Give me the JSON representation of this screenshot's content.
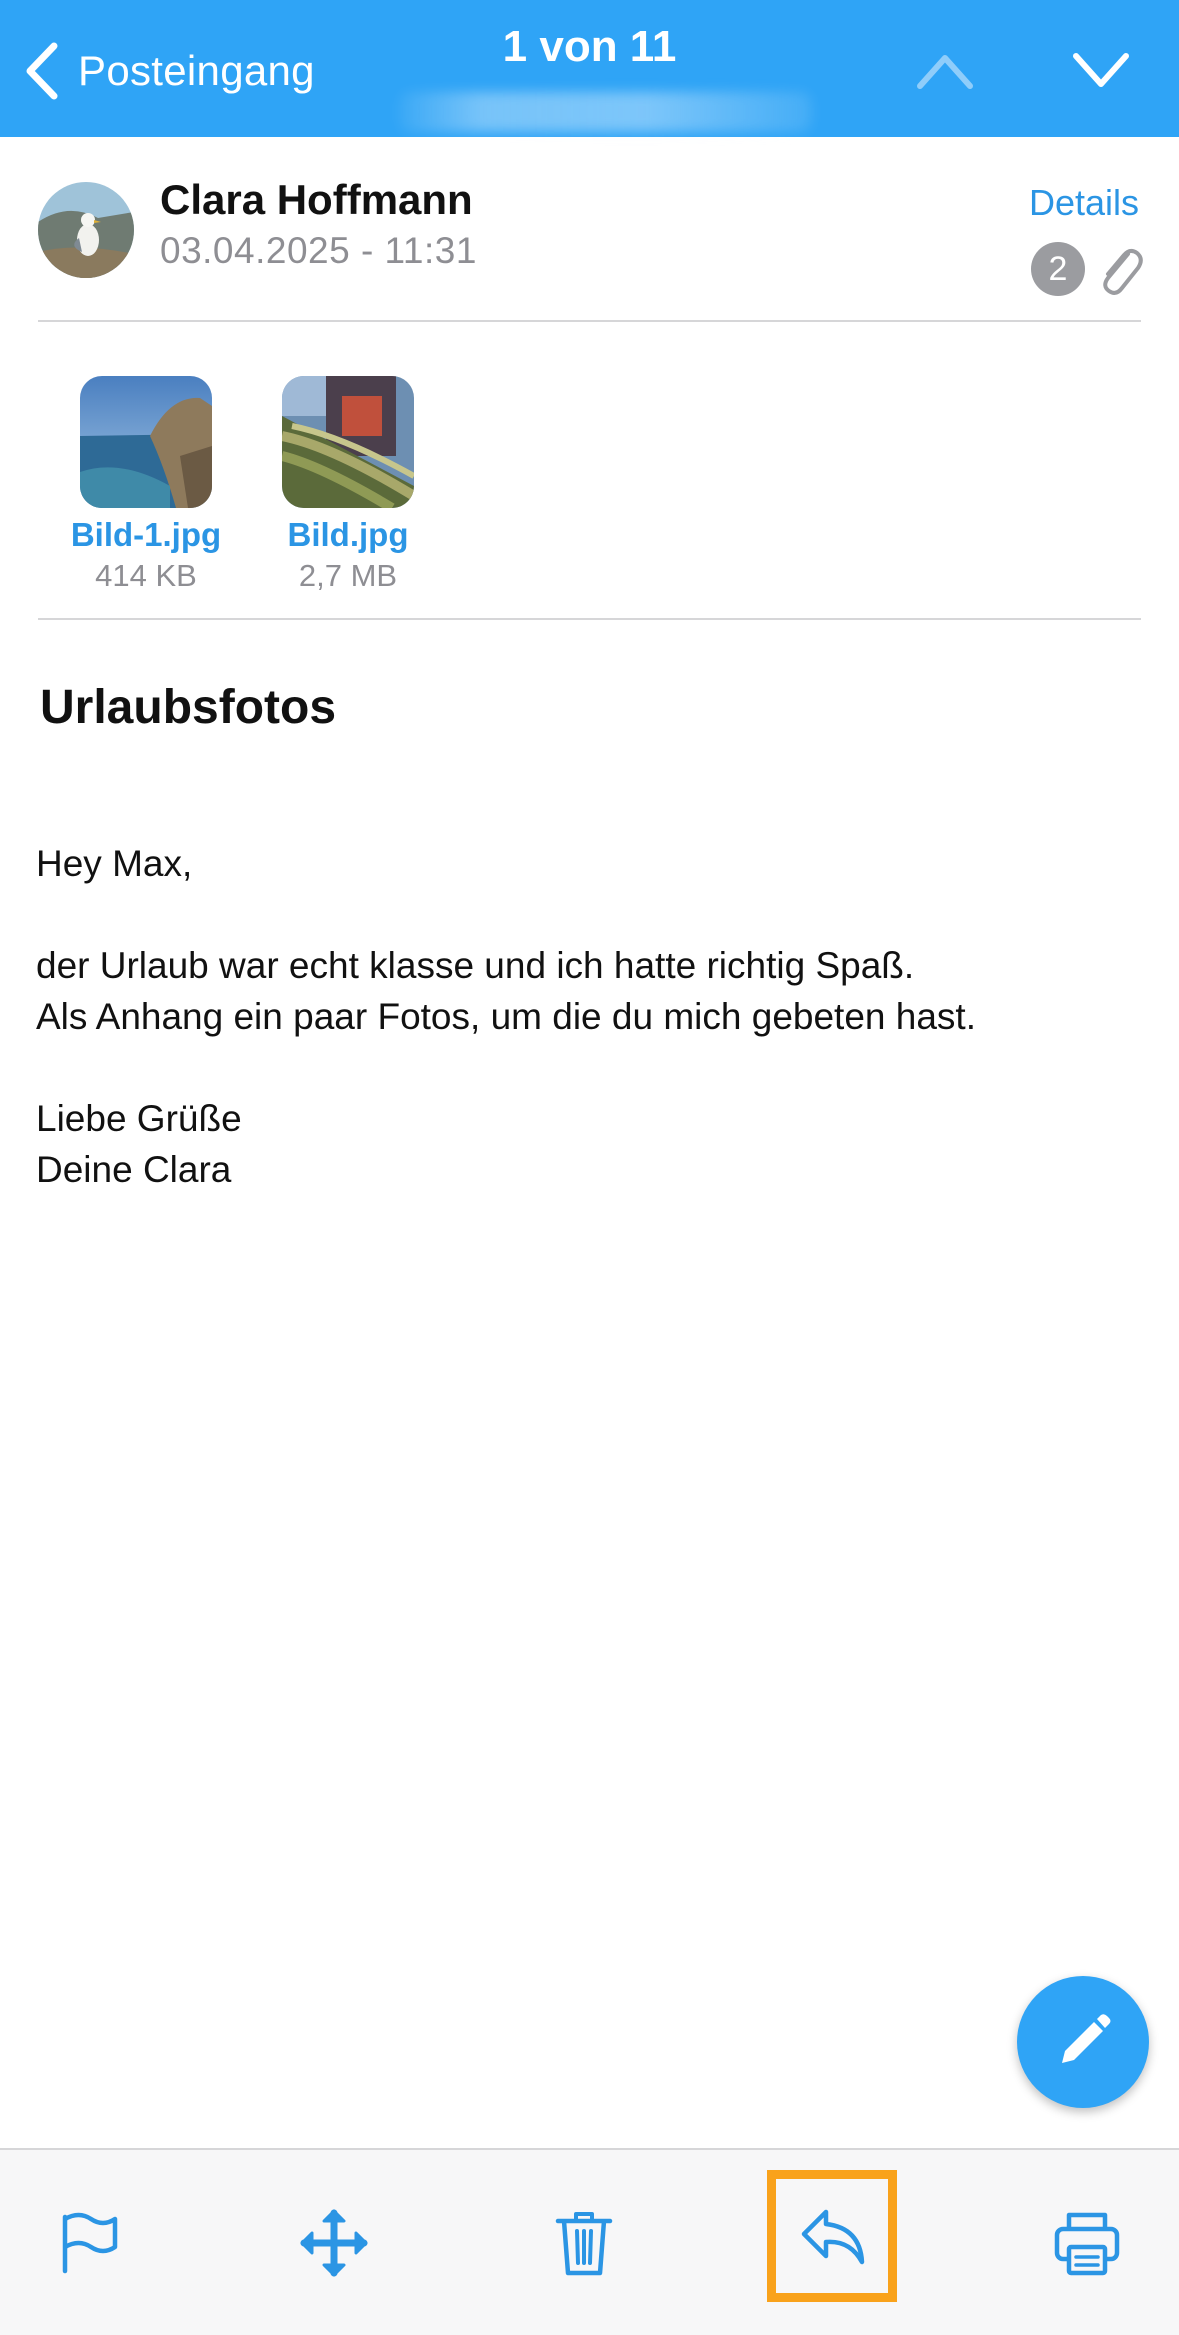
{
  "navbar": {
    "back_label": "Posteingang",
    "counter": "1 von 11",
    "background_color": "#2fa4f6"
  },
  "sender": {
    "name": "Clara Hoffmann",
    "date": "03.04.2025 - 11:31",
    "details_label": "Details",
    "attachment_count": "2"
  },
  "attachments": [
    {
      "name": "Bild-1.jpg",
      "size": "414 KB"
    },
    {
      "name": "Bild.jpg",
      "size": "2,7 MB"
    }
  ],
  "mail": {
    "subject": "Urlaubsfotos",
    "lines": [
      "Hey Max,",
      "",
      "der Urlaub war echt klasse und ich hatte richtig Spaß.",
      "Als Anhang ein paar Fotos, um die du mich gebeten hast.",
      "",
      "Liebe Grüße",
      "Deine Clara"
    ]
  },
  "toolbar": {
    "items": [
      "flag-icon",
      "move-icon",
      "trash-icon",
      "reply-icon",
      "print-icon"
    ],
    "highlighted": "reply-icon",
    "highlight_color": "#f9a21b",
    "icon_color": "#2b95e4"
  },
  "fab": {
    "icon": "compose-pencil-icon"
  }
}
